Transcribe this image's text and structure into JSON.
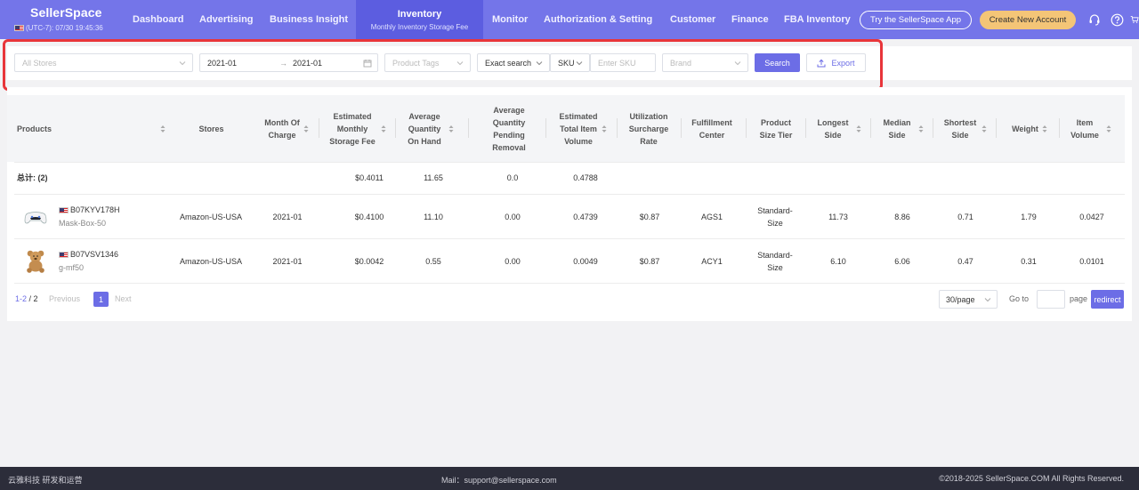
{
  "brand": {
    "name": "SellerSpace",
    "timezone": "(UTC-7): 07/30 19:45:36"
  },
  "nav": {
    "items": [
      "Dashboard",
      "Advertising",
      "Business Insight",
      "Monitor",
      "Authorization & Setting",
      "Customer",
      "Finance",
      "FBA Inventory"
    ],
    "active": {
      "label": "Inventory",
      "sub": "Monthly Inventory Storage Fee"
    },
    "try_label": "Try the SellerSpace App",
    "create_label": "Create New Account",
    "accent": "#7475e9",
    "create_color": "#f4c577"
  },
  "filters": {
    "stores_placeholder": "All Stores",
    "date_from": "2021-01",
    "date_to": "2021-01",
    "tags_placeholder": "Product Tags",
    "search_mode": "Exact search",
    "field_type": "SKU",
    "sku_placeholder": "Enter SKU",
    "brand_placeholder": "Brand",
    "search_label": "Search",
    "export_label": "Export"
  },
  "table": {
    "headers": [
      "Products",
      "Stores",
      "Month Of Charge",
      "Estimated Monthly Storage Fee",
      "Average Quantity On Hand",
      "Average Quantity Pending Removal",
      "Estimated Total Item Volume",
      "Utilization Surcharge Rate",
      "Fulfillment Center",
      "Product Size Tier",
      "Longest Side",
      "Median Side",
      "Shortest Side",
      "Weight",
      "Item Volume"
    ],
    "summary": {
      "label": "总计: (2)",
      "fee": "$0.4011",
      "on_hand": "11.65",
      "pending": "0.0",
      "volume": "0.4788"
    },
    "rows": [
      {
        "image": "game-controller-icon",
        "asin": "B07KYV178H",
        "sku": "Mask-Box-50",
        "store": "Amazon-US-USA",
        "month": "2021-01",
        "fee": "$0.4100",
        "on_hand": "11.10",
        "pending": "0.00",
        "total_volume": "0.4739",
        "surcharge": "$0.87",
        "center": "AGS1",
        "tier_line1": "Standard-",
        "tier_line2": "Size",
        "longest": "11.73",
        "median": "8.86",
        "shortest": "0.71",
        "weight": "1.79",
        "item_volume": "0.0427"
      },
      {
        "image": "teddy-bear-icon",
        "asin": "B07VSV1346",
        "sku": "g-mf50",
        "store": "Amazon-US-USA",
        "month": "2021-01",
        "fee": "$0.0042",
        "on_hand": "0.55",
        "pending": "0.00",
        "total_volume": "0.0049",
        "surcharge": "$0.87",
        "center": "ACY1",
        "tier_line1": "Standard-",
        "tier_line2": "Size",
        "longest": "6.10",
        "median": "6.06",
        "shortest": "0.47",
        "weight": "0.31",
        "item_volume": "0.0101"
      }
    ]
  },
  "pagination": {
    "range": "1-2",
    "total": " / 2",
    "prev_label": "Previous",
    "current": "1",
    "next_label": "Next",
    "page_size": "30/page",
    "goto_label": "Go to",
    "page_label": "page",
    "redirect_label": "redirect"
  },
  "footer": {
    "left": "云雅科技 研发和运营",
    "mail": "Mail：support@sellerspace.com",
    "copyright": "©2018-2025 SellerSpace.COM All Rights Reserved."
  }
}
